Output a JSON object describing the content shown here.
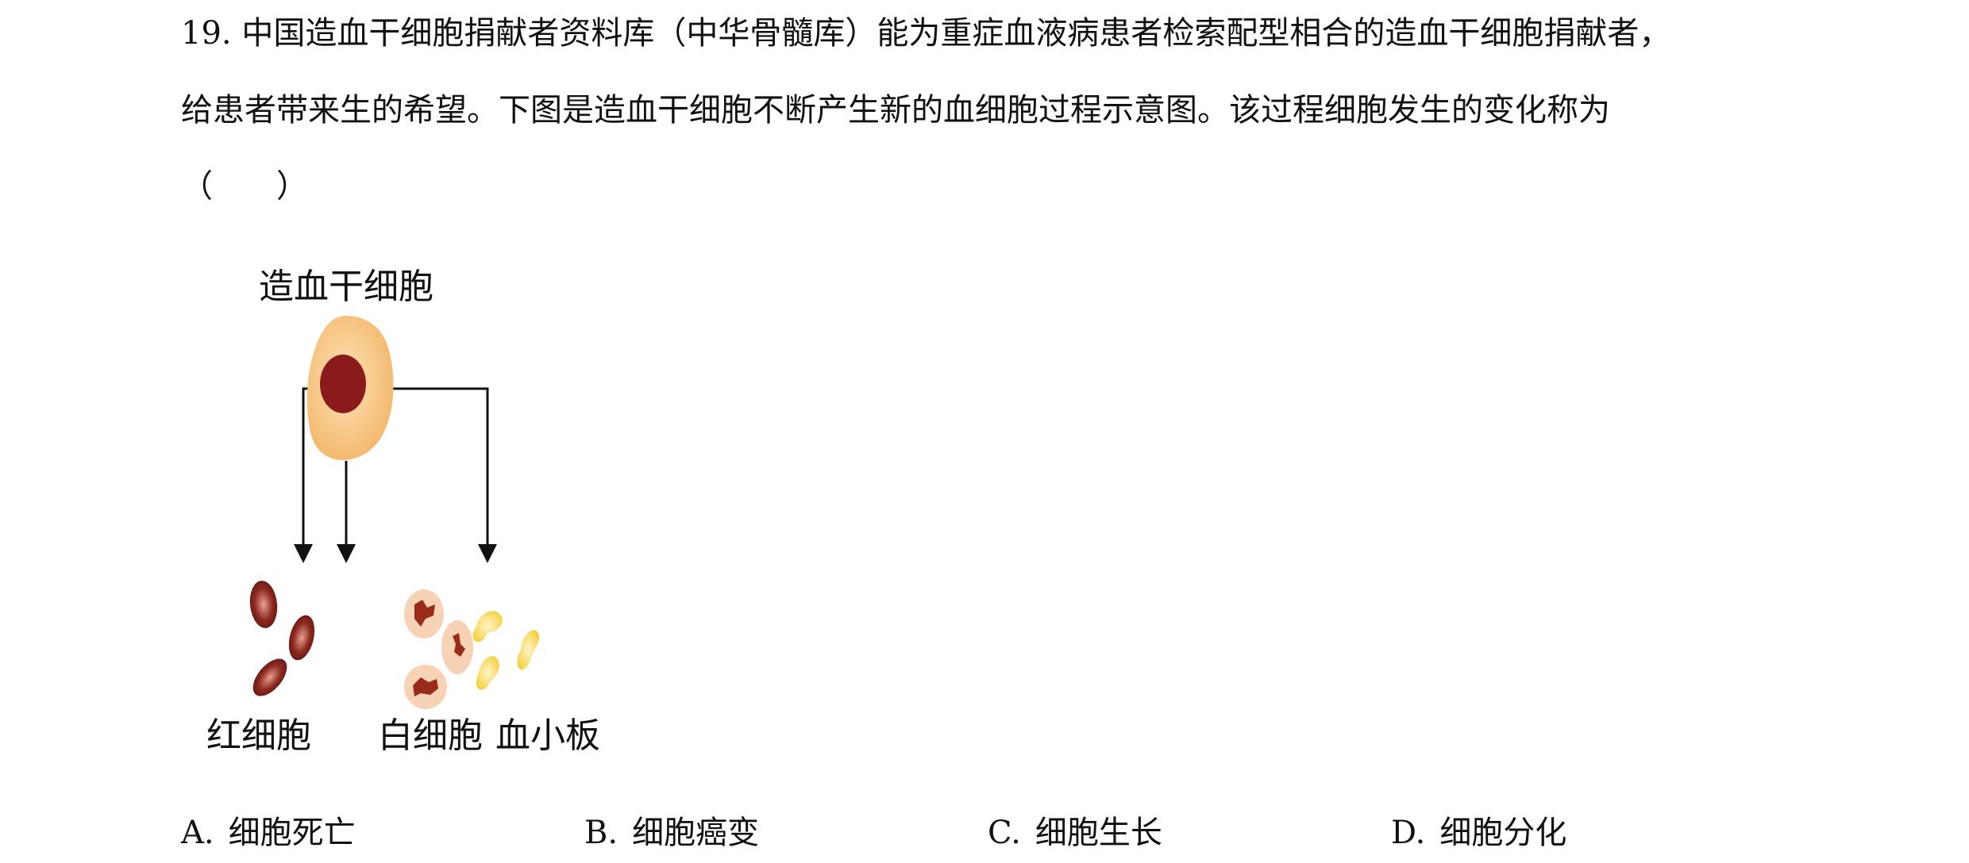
{
  "question": {
    "number": "19.",
    "line1": "中国造血干细胞捐献者资料库（中华骨髓库）能为重症血液病患者检索配型相合的造血干细胞捐献者，",
    "line2": "给患者带来生的希望。下图是造血干细胞不断产生新的血细胞过程示意图。该过程细胞发生的变化称为",
    "blank": "（　　）"
  },
  "figure": {
    "top_label": "造血干细胞",
    "labels": [
      "红细胞",
      "白细胞",
      "血小板"
    ],
    "colors": {
      "stem_cytoplasm": "#f3b76a",
      "stem_nucleus": "#8b1a1a",
      "red_cell": "#8e2a22",
      "white_cell_body": "#f8d2b4",
      "white_cell_nucleus": "#9a2a1a",
      "platelet": "#f4cf3c"
    }
  },
  "options": [
    {
      "letter": "A.",
      "text": "细胞死亡"
    },
    {
      "letter": "B.",
      "text": "细胞癌变"
    },
    {
      "letter": "C.",
      "text": "细胞生长"
    },
    {
      "letter": "D.",
      "text": "细胞分化"
    }
  ]
}
